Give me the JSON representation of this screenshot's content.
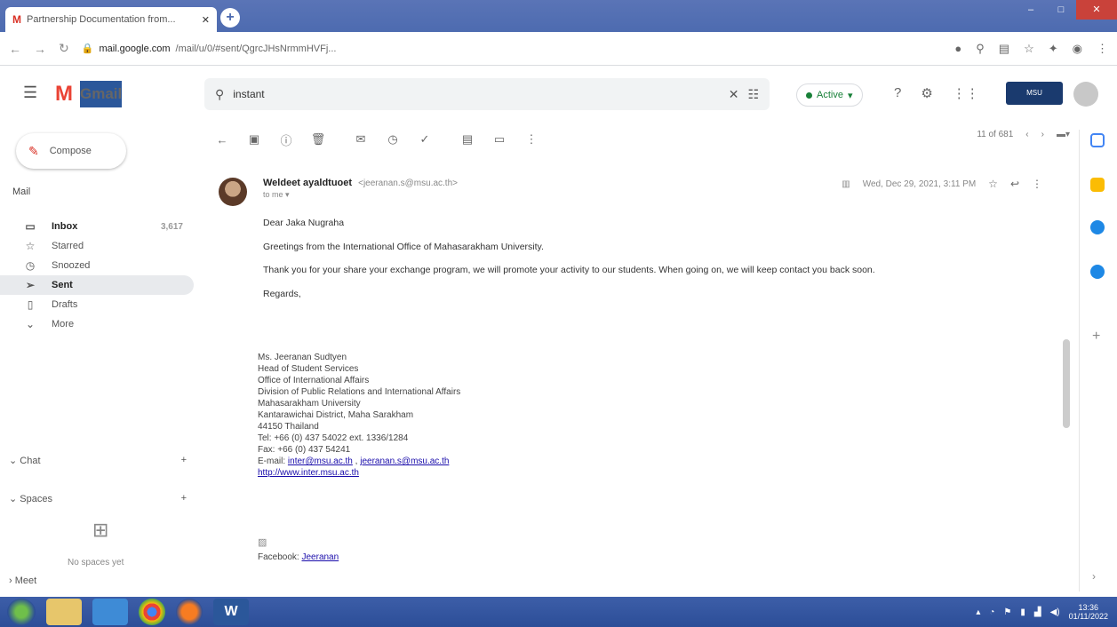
{
  "browser": {
    "tab_title": "Partnership Documentation from...",
    "tab_favicon": "M",
    "url_host": "mail.google.com",
    "url_path": "/mail/u/0/#sent/QgrcJHsNrmmHVFj...",
    "accent": "#4d6bb0"
  },
  "gmail": {
    "logo_letter": "M",
    "logo_word": "Gmail",
    "search_value": "instant",
    "status_label": "Active",
    "workspace_label": "MSU"
  },
  "sidebar": {
    "compose_label": "Compose",
    "mail_section": "Mail",
    "items": [
      {
        "label": "Inbox",
        "count": "3,617"
      },
      {
        "label": "Starred",
        "count": ""
      },
      {
        "label": "Snoozed",
        "count": ""
      },
      {
        "label": "Sent",
        "count": ""
      },
      {
        "label": "Drafts",
        "count": ""
      },
      {
        "label": "More",
        "count": ""
      }
    ],
    "chat_label": "Chat",
    "spaces_label": "Spaces",
    "no_spaces": "No spaces yet",
    "meet_label": "Meet"
  },
  "toolbar": {
    "pager": "11 of 681"
  },
  "email": {
    "sender_name": "Weldeet ayaldtuoet",
    "sender_email": "<jeeranan.s@msu.ac.th>",
    "to": "to me",
    "date": "Wed, Dec 29, 2021, 3:11 PM",
    "greeting": "Dear Jaka Nugraha",
    "para1": "Greetings from the International Office of Mahasarakham University.",
    "para2": "Thank you for your share your exchange program, we will promote your activity to our students. When going on, we will keep contact you back soon.",
    "closing": "Regards,",
    "sig_name": "Ms. Jeeranan  Sudtyen",
    "sig_title": "Head of Student Services",
    "sig_office": "Office of International Affairs",
    "sig_division": "Division of Public Relations and International Affairs",
    "sig_univ": "Mahasarakham University",
    "sig_district": "Kantarawichai District, Maha Sarakham",
    "sig_country": "44150 Thailand",
    "sig_tel": "Tel: +66 (0) 437 54022 ext. 1336/1284",
    "sig_fax": "Fax: +66 (0) 437 54241",
    "sig_email_label": "E-mail:",
    "sig_email1": "inter@msu.ac.th",
    "sig_email2": "jeeranan.s@msu.ac.th",
    "sig_web": "http://www.inter.msu.ac.th",
    "fb_label": "Facebook:",
    "fb_link": "Jeeranan"
  },
  "taskbar": {
    "time": "13:36",
    "date": "01/11/2022"
  }
}
